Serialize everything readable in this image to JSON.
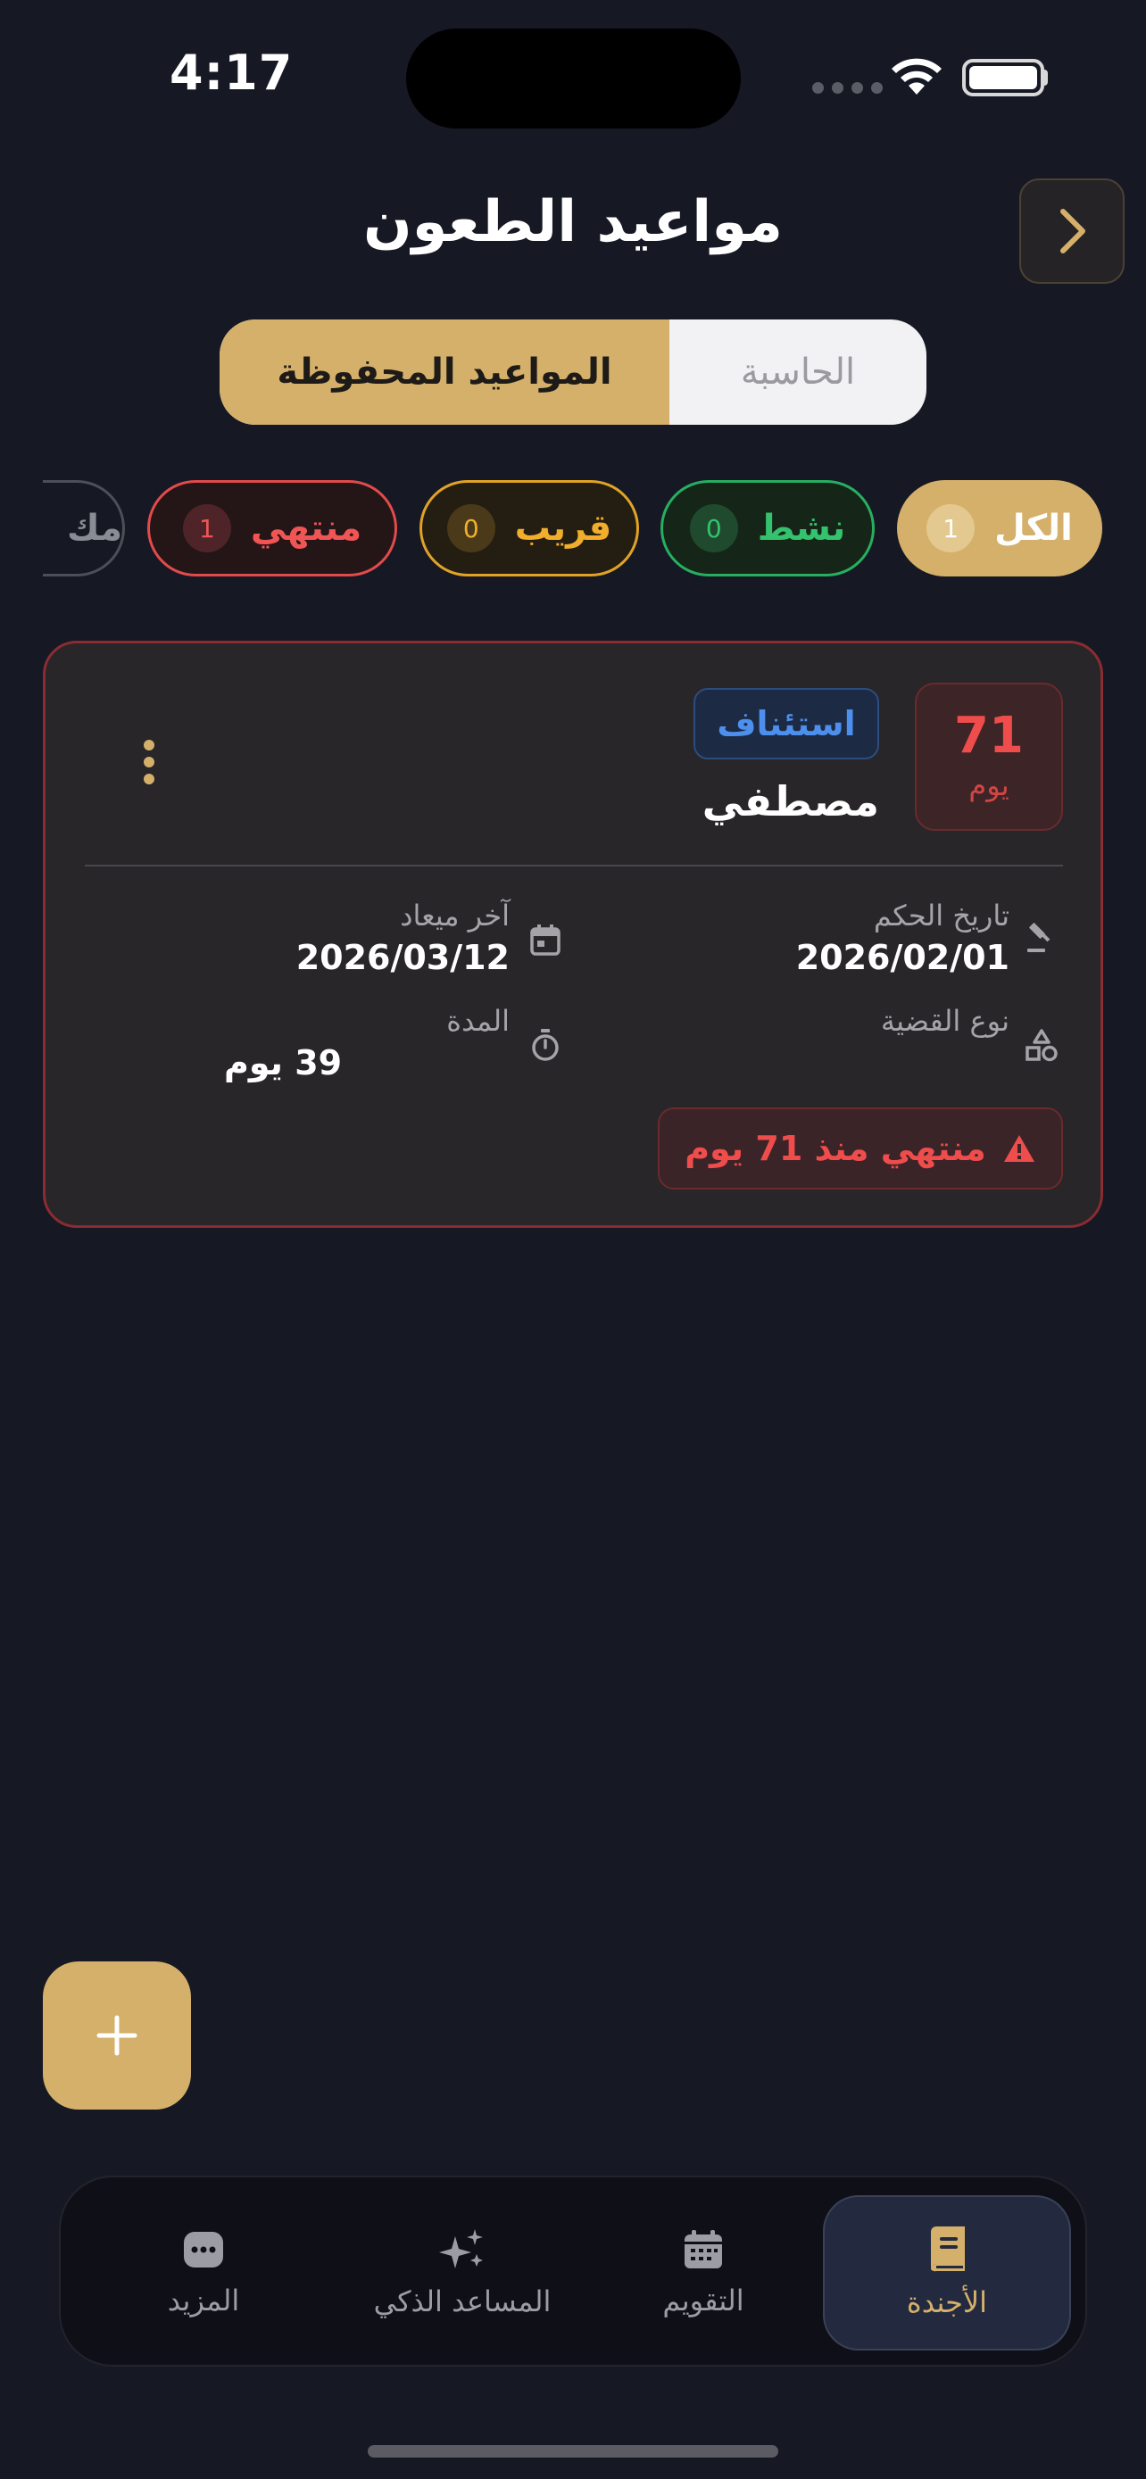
{
  "status_bar": {
    "time": "4:17"
  },
  "header": {
    "title": "مواعيد الطعون"
  },
  "segment": {
    "saved": "المواعيد المحفوظة",
    "calculator": "الحاسبة"
  },
  "filters": {
    "all": {
      "label": "الكل",
      "count": "1"
    },
    "active": {
      "label": "نشط",
      "count": "0"
    },
    "near": {
      "label": "قريب",
      "count": "0"
    },
    "expired": {
      "label": "منتهي",
      "count": "1"
    },
    "more": {
      "label": "مك"
    }
  },
  "card": {
    "days": "71",
    "days_label": "يوم",
    "type": "استئناف",
    "client": "مصطفي",
    "judgment_date_label": "تاريخ الحكم",
    "judgment_date": "2026/02/01",
    "deadline_label": "آخر ميعاد",
    "deadline": "2026/03/12",
    "case_type_label": "نوع القضية",
    "duration_label": "المدة",
    "duration": "39 يوم",
    "status": "منتهي منذ 71 يوم"
  },
  "nav": {
    "agenda": "الأجندة",
    "calendar": "التقويم",
    "assistant": "المساعد الذكي",
    "more": "المزيد"
  },
  "colors": {
    "accent": "#d4b06a",
    "background": "#161824",
    "expired": "#ef4c4c",
    "active": "#34c26e",
    "near": "#f0ae2c",
    "info": "#4d8fec"
  }
}
